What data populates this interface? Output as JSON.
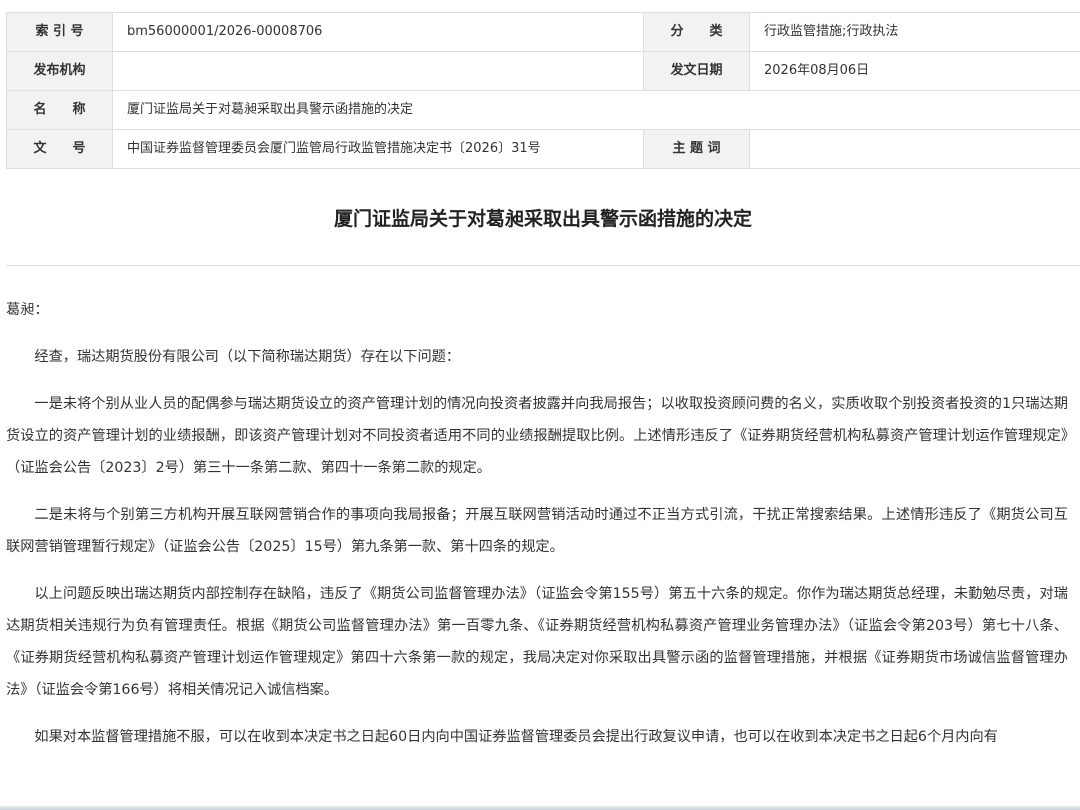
{
  "meta": {
    "index_label": "索 引 号",
    "index_value": "bm56000001/2026-00008706",
    "category_label": "分　　类",
    "category_value": "行政监管措施;行政执法",
    "issuer_label": "发布机构",
    "issuer_value": "",
    "date_label": "发文日期",
    "date_value": "2026年08月06日",
    "name_label": "名　　称",
    "name_value": "厦门证监局关于对葛昶采取出具警示函措施的决定",
    "docno_label": "文　　号",
    "docno_value": "中国证券监督管理委员会厦门监管局行政监管措施决定书〔2026〕31号",
    "keywords_label": "主 题 词",
    "keywords_value": ""
  },
  "document": {
    "title": "厦门证监局关于对葛昶采取出具警示函措施的决定",
    "salutation": "葛昶：",
    "paragraphs": [
      "经查，瑞达期货股份有限公司（以下简称瑞达期货）存在以下问题：",
      "一是未将个别从业人员的配偶参与瑞达期货设立的资产管理计划的情况向投资者披露并向我局报告；以收取投资顾问费的名义，实质收取个别投资者投资的1只瑞达期货设立的资产管理计划的业绩报酬，即该资产管理计划对不同投资者适用不同的业绩报酬提取比例。上述情形违反了《证券期货经营机构私募资产管理计划运作管理规定》（证监会公告〔2023〕2号）第三十一条第二款、第四十一条第二款的规定。",
      "二是未将与个别第三方机构开展互联网营销合作的事项向我局报备；开展互联网营销活动时通过不正当方式引流，干扰正常搜索结果。上述情形违反了《期货公司互联网营销管理暂行规定》（证监会公告〔2025〕15号）第九条第一款、第十四条的规定。",
      "以上问题反映出瑞达期货内部控制存在缺陷，违反了《期货公司监督管理办法》（证监会令第155号）第五十六条的规定。你作为瑞达期货总经理，未勤勉尽责，对瑞达期货相关违规行为负有管理责任。根据《期货公司监督管理办法》第一百零九条、《证券期货经营机构私募资产管理业务管理办法》（证监会令第203号）第七十八条、《证券期货经营机构私募资产管理计划运作管理规定》第四十六条第一款的规定，我局决定对你采取出具警示函的监督管理措施，并根据《证券期货市场诚信监督管理办法》（证监会令第166号）将相关情况记入诚信档案。",
      "如果对本监督管理措施不服，可以在收到本决定书之日起60日内向中国证券监督管理委员会提出行政复议申请，也可以在收到本决定书之日起6个月内向有"
    ]
  }
}
